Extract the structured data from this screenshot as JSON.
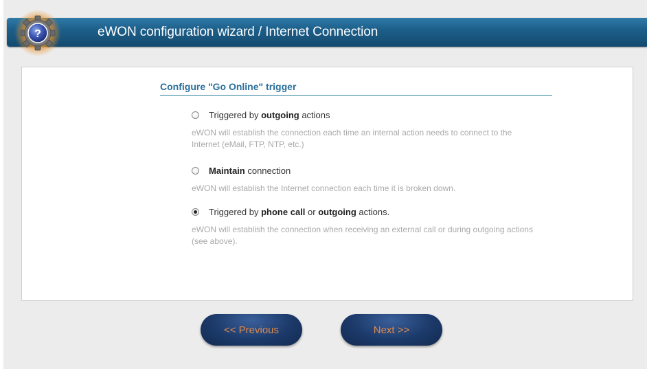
{
  "header": {
    "title": "eWON configuration wizard / Internet Connection",
    "icon": "help-gear-icon"
  },
  "section": {
    "title": "Configure \"Go Online\" trigger"
  },
  "options": [
    {
      "selected": false,
      "prefix": "Triggered by ",
      "strong1": "outgoing",
      "mid": " actions",
      "strong2": "",
      "suffix": "",
      "description": "eWON will establish the connection each time an internal action needs to connect to the Internet (eMail, FTP, NTP, etc.)"
    },
    {
      "selected": false,
      "prefix": "",
      "strong1": "Maintain",
      "mid": " connection",
      "strong2": "",
      "suffix": "",
      "description": "eWON will establish the Internet connection each time it is broken down."
    },
    {
      "selected": true,
      "prefix": "Triggered by ",
      "strong1": "phone call",
      "mid": " or ",
      "strong2": "outgoing",
      "suffix": " actions.",
      "description": "eWON will establish the connection when receiving an external call or during outgoing actions (see above)."
    }
  ],
  "buttons": {
    "previous": "<< Previous",
    "next": "Next >>"
  },
  "colors": {
    "header": "#1d5f8a",
    "title_accent": "#2a6f9b",
    "button_bg": "#1c3a6a",
    "button_text": "#e08a4a"
  }
}
